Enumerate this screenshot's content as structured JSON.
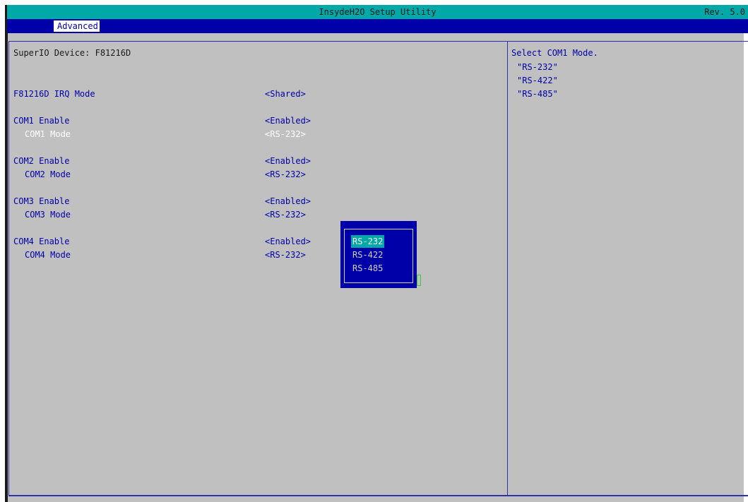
{
  "window": {
    "title": "InsydeH2O Setup Utility",
    "revision": "Rev. 5.0"
  },
  "menu": {
    "tabs": [
      {
        "label": "Advanced",
        "active": true
      }
    ]
  },
  "main": {
    "device_heading": "SuperIO Device: F81216D",
    "settings": [
      {
        "label": "F81216D IRQ Mode",
        "value": "<Shared>"
      },
      {
        "label": "COM1 Enable",
        "value": "<Enabled>"
      },
      {
        "label": "COM1 Mode",
        "value": "<RS-232>",
        "selected": true
      },
      {
        "label": "COM2 Enable",
        "value": "<Enabled>"
      },
      {
        "label": "COM2 Mode",
        "value": "<RS-232>"
      },
      {
        "label": "COM3 Enable",
        "value": "<Enabled>"
      },
      {
        "label": "COM3 Mode",
        "value": "<RS-232>"
      },
      {
        "label": "COM4 Enable",
        "value": "<Enabled>"
      },
      {
        "label": "COM4 Mode",
        "value": "<RS-232>"
      }
    ]
  },
  "help": {
    "title": "Select COM1 Mode.",
    "lines": [
      "\"RS-232\"",
      "\"RS-422\"",
      "\"RS-485\""
    ]
  },
  "popup": {
    "options": [
      "RS-232",
      "RS-422",
      "RS-485"
    ],
    "highlighted": "RS-232"
  },
  "colors": {
    "title_bar": "#00a8a8",
    "menu_bar": "#0000a8",
    "background": "#c0c0c0",
    "text_blue": "#0000a8",
    "popup": "#0000a8",
    "highlight": "#00a8a8"
  }
}
